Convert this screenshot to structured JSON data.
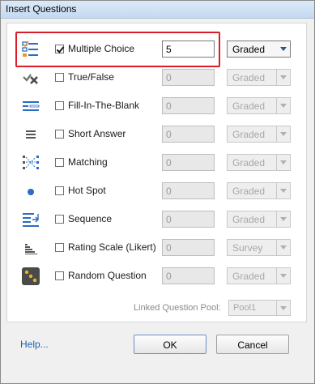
{
  "window": {
    "title": "Insert Questions"
  },
  "rows": [
    {
      "icon": "multiple-choice-icon",
      "label": "Multiple Choice",
      "checked": true,
      "count": "5",
      "grade": "Graded",
      "enabled": true
    },
    {
      "icon": "true-false-icon",
      "label": "True/False",
      "checked": false,
      "count": "0",
      "grade": "Graded",
      "enabled": false
    },
    {
      "icon": "fill-in-blank-icon",
      "label": "Fill-In-The-Blank",
      "checked": false,
      "count": "0",
      "grade": "Graded",
      "enabled": false
    },
    {
      "icon": "short-answer-icon",
      "label": "Short Answer",
      "checked": false,
      "count": "0",
      "grade": "Graded",
      "enabled": false
    },
    {
      "icon": "matching-icon",
      "label": "Matching",
      "checked": false,
      "count": "0",
      "grade": "Graded",
      "enabled": false
    },
    {
      "icon": "hot-spot-icon",
      "label": "Hot Spot",
      "checked": false,
      "count": "0",
      "grade": "Graded",
      "enabled": false
    },
    {
      "icon": "sequence-icon",
      "label": "Sequence",
      "checked": false,
      "count": "0",
      "grade": "Graded",
      "enabled": false
    },
    {
      "icon": "rating-scale-icon",
      "label": "Rating Scale (Likert)",
      "checked": false,
      "count": "0",
      "grade": "Survey",
      "enabled": false
    },
    {
      "icon": "random-question-icon",
      "label": "Random Question",
      "checked": false,
      "count": "0",
      "grade": "Graded",
      "enabled": false
    }
  ],
  "pool": {
    "label": "Linked Question Pool:",
    "value": "Pool1"
  },
  "footer": {
    "help": "Help...",
    "ok": "OK",
    "cancel": "Cancel"
  },
  "colors": {
    "accent": "#2d6bc4",
    "highlight": "#d91e2a",
    "link": "#1f5fb0"
  }
}
